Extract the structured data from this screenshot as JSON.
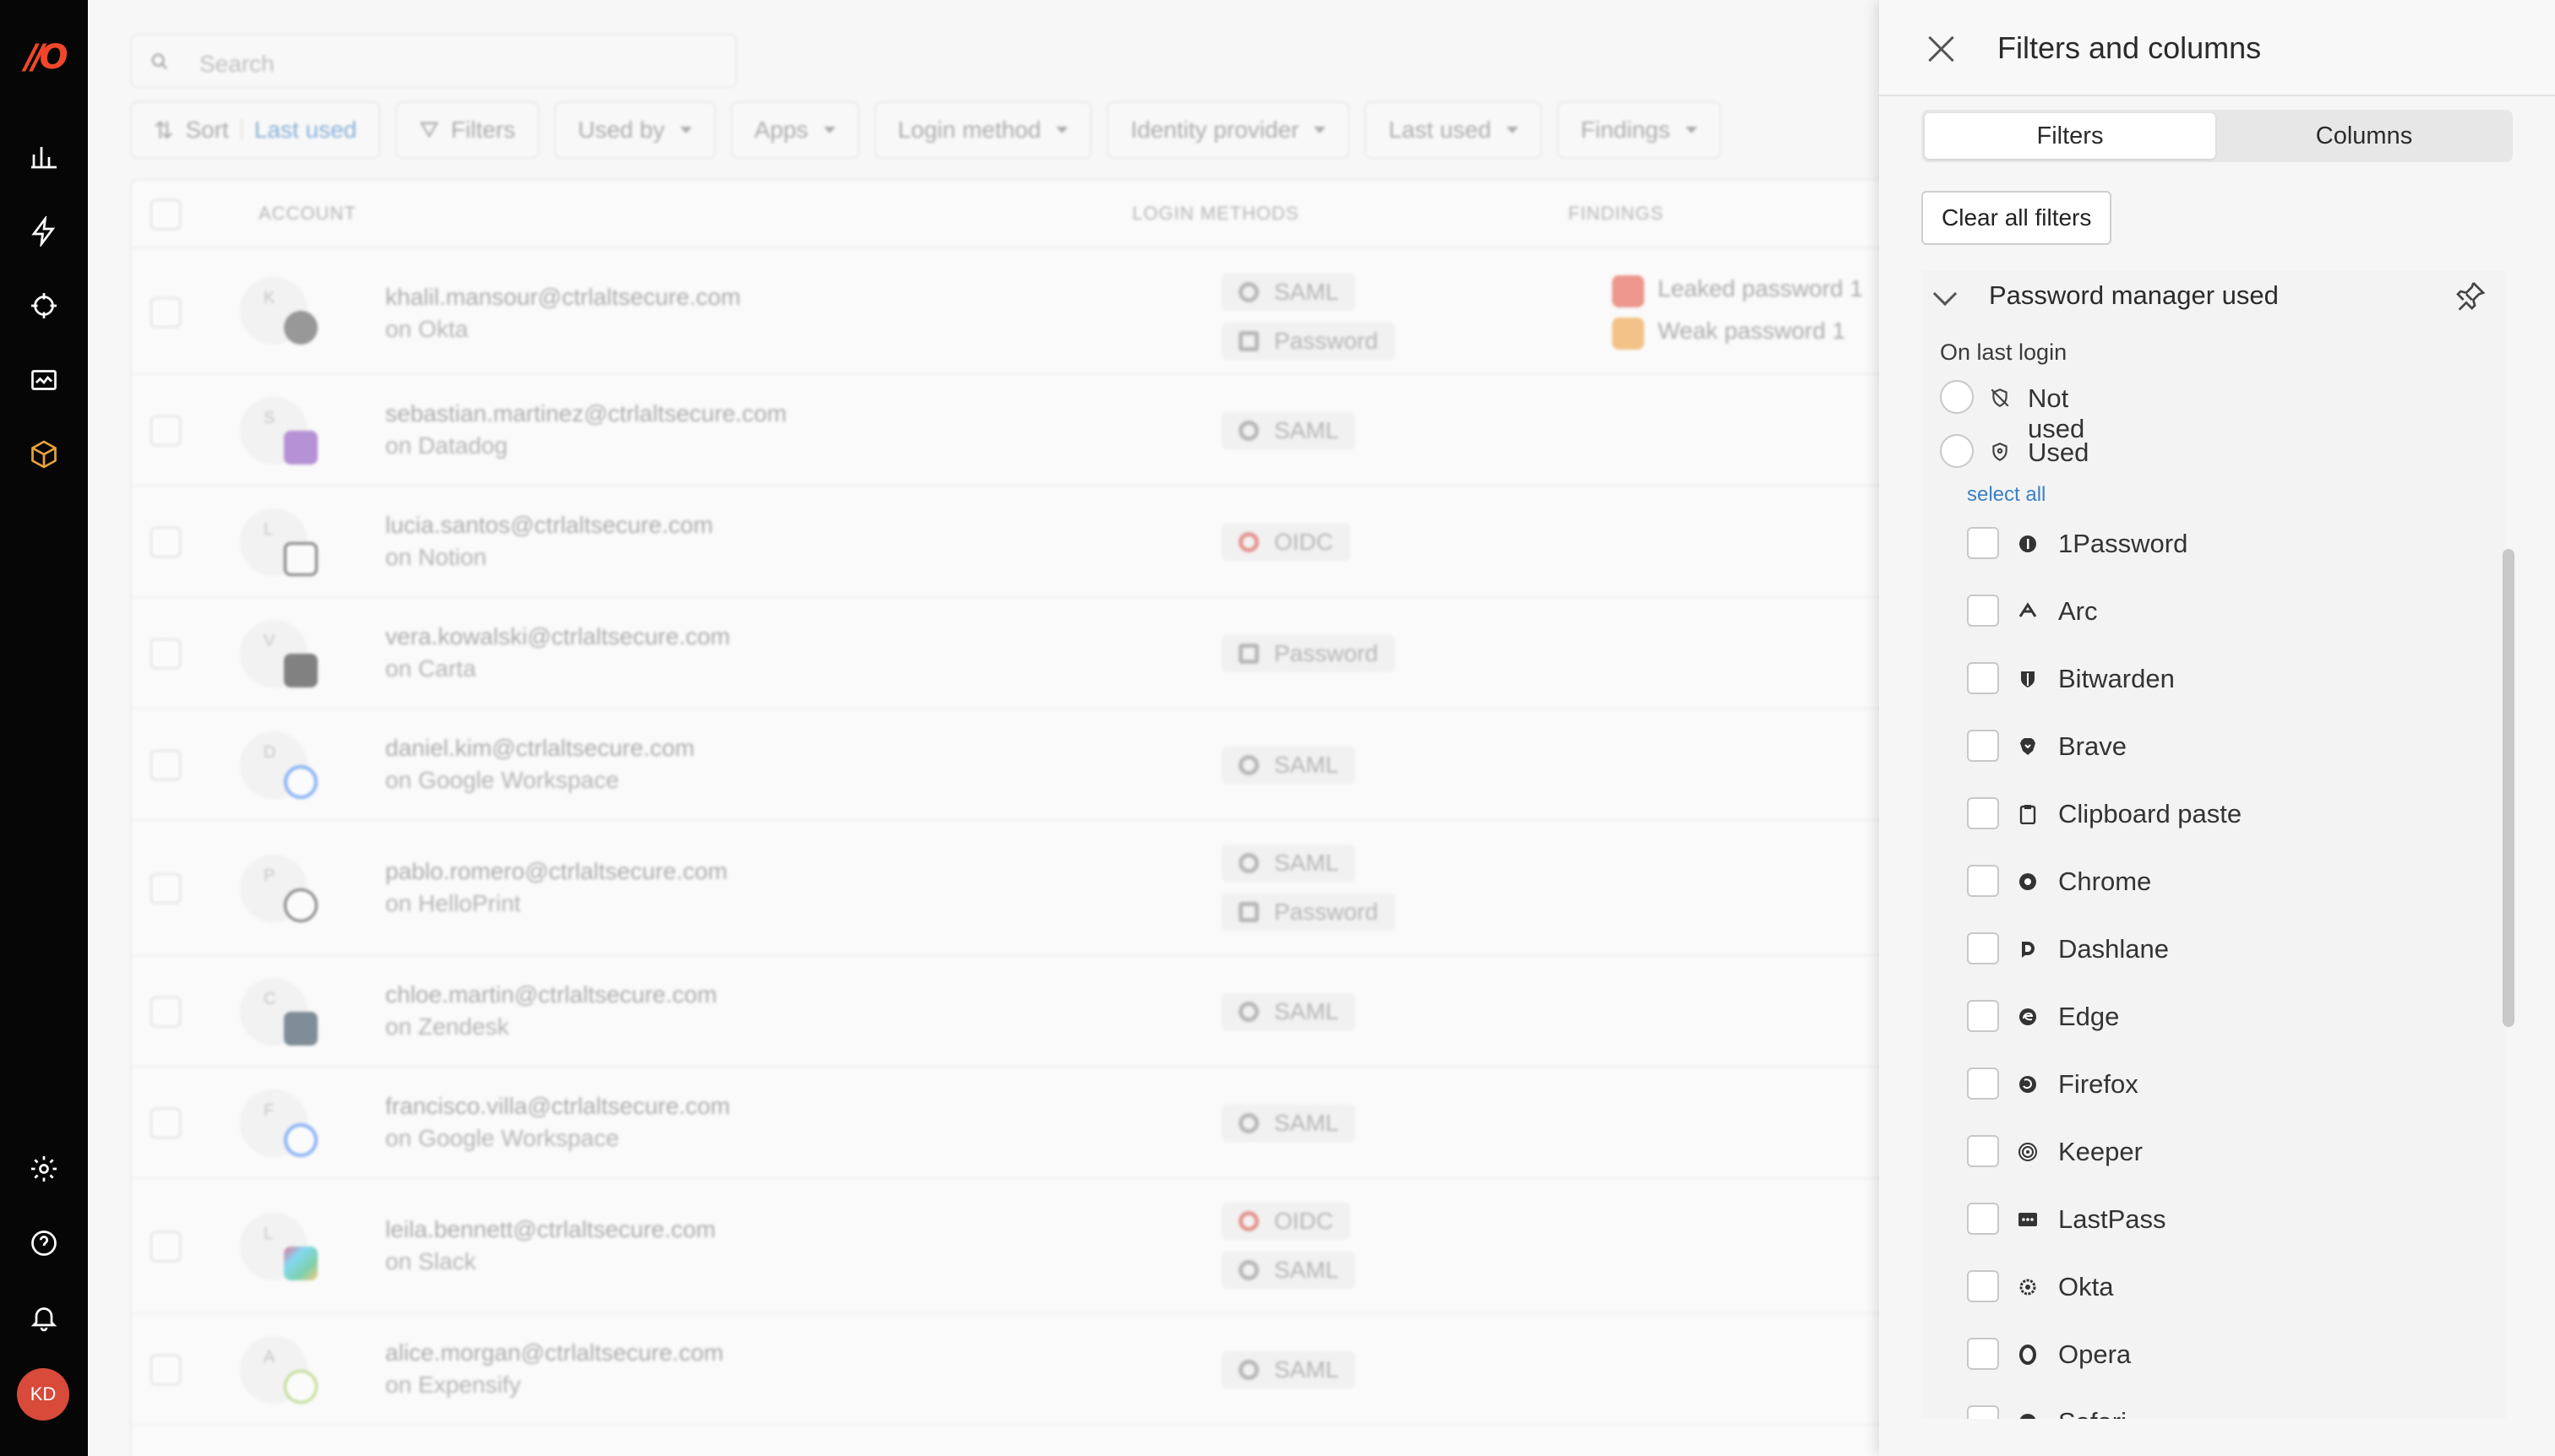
{
  "app": {
    "logo_text": "//O",
    "user_initials": "KD",
    "brand_color": "#f0472a"
  },
  "nav": {
    "top_icons": [
      "bar-chart-icon",
      "lightning-icon",
      "crosshair-icon",
      "activity-icon",
      "cube-icon"
    ],
    "bottom_icons": [
      "gear-icon",
      "help-icon",
      "bell-icon"
    ]
  },
  "main": {
    "search_placeholder": "Search",
    "sort": {
      "label": "Sort",
      "value": "Last used"
    },
    "filters_label": "Filters",
    "dropdowns": [
      "Used by",
      "Apps",
      "Login method",
      "Identity provider",
      "Last used",
      "Findings"
    ],
    "columns": {
      "account": "ACCOUNT",
      "login_methods": "LOGIN METHODS",
      "findings": "FINDINGS"
    },
    "rows": [
      {
        "initial": "K",
        "email": "khalil.mansour@ctrlaltsecure.com",
        "app": "on Okta",
        "methods": [
          "SAML",
          "Password"
        ],
        "findings": [
          "Leaked password 1",
          "Weak password 1"
        ]
      },
      {
        "initial": "S",
        "email": "sebastian.martinez@ctrlaltsecure.com",
        "app": "on Datadog",
        "methods": [
          "SAML"
        ],
        "findings": []
      },
      {
        "initial": "L",
        "email": "lucia.santos@ctrlaltsecure.com",
        "app": "on Notion",
        "methods": [
          "OIDC"
        ],
        "findings": []
      },
      {
        "initial": "V",
        "email": "vera.kowalski@ctrlaltsecure.com",
        "app": "on Carta",
        "methods": [
          "Password"
        ],
        "findings": []
      },
      {
        "initial": "D",
        "email": "daniel.kim@ctrlaltsecure.com",
        "app": "on Google Workspace",
        "methods": [
          "SAML"
        ],
        "findings": []
      },
      {
        "initial": "P",
        "email": "pablo.romero@ctrlaltsecure.com",
        "app": "on HelloPrint",
        "methods": [
          "SAML",
          "Password"
        ],
        "findings": []
      },
      {
        "initial": "C",
        "email": "chloe.martin@ctrlaltsecure.com",
        "app": "on Zendesk",
        "methods": [
          "SAML"
        ],
        "findings": []
      },
      {
        "initial": "F",
        "email": "francisco.villa@ctrlaltsecure.com",
        "app": "on Google Workspace",
        "methods": [
          "SAML"
        ],
        "findings": []
      },
      {
        "initial": "L",
        "email": "leila.bennett@ctrlaltsecure.com",
        "app": "on Slack",
        "methods": [
          "OIDC",
          "SAML"
        ],
        "findings": []
      },
      {
        "initial": "A",
        "email": "alice.morgan@ctrlaltsecure.com",
        "app": "on Expensify",
        "methods": [
          "SAML"
        ],
        "findings": []
      }
    ]
  },
  "panel": {
    "title": "Filters and columns",
    "tabs": {
      "filters": "Filters",
      "columns": "Columns"
    },
    "clear_label": "Clear all filters",
    "section_title": "Password manager used",
    "subheading": "On last login",
    "radio_not_used": "Not used",
    "radio_used": "Used",
    "select_all": "select all",
    "options": [
      "1Password",
      "Arc",
      "Bitwarden",
      "Brave",
      "Clipboard paste",
      "Chrome",
      "Dashlane",
      "Edge",
      "Firefox",
      "Keeper",
      "LastPass",
      "Okta",
      "Opera",
      "Safari"
    ]
  }
}
